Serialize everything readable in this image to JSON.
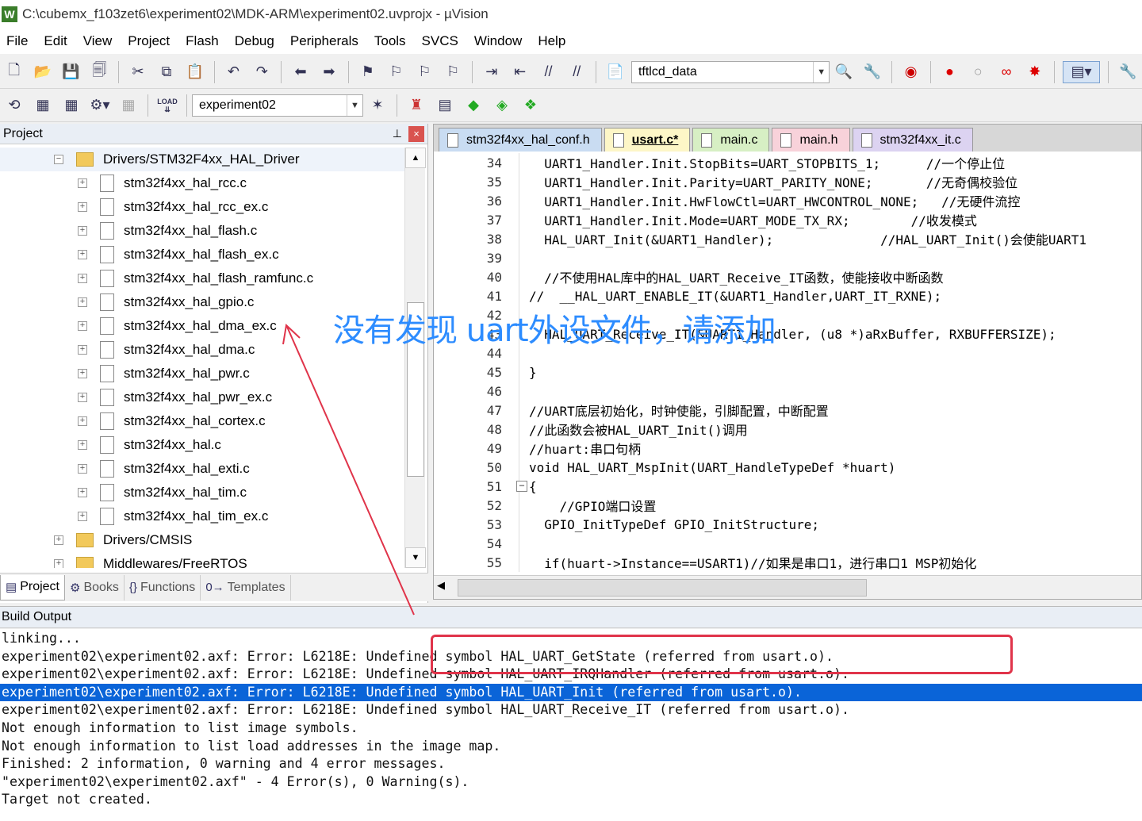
{
  "window": {
    "title": "C:\\cubemx_f103zet6\\experiment02\\MDK-ARM\\experiment02.uvprojx - µVision",
    "app_icon": "W"
  },
  "menu": [
    "File",
    "Edit",
    "View",
    "Project",
    "Flash",
    "Debug",
    "Peripherals",
    "Tools",
    "SVCS",
    "Window",
    "Help"
  ],
  "toolbar1": {
    "find_combo_value": "tftlcd_data"
  },
  "toolbar2": {
    "load_label": "LOAD",
    "target_combo_value": "experiment02"
  },
  "project_panel": {
    "title": "Project",
    "pin_glyph": "📌",
    "close_glyph": "×",
    "tree": [
      {
        "label": "Drivers/STM32F4xx_HAL_Driver",
        "type": "folder",
        "level": 1,
        "expanded": true
      },
      {
        "label": "stm32f4xx_hal_rcc.c",
        "type": "file",
        "level": 2
      },
      {
        "label": "stm32f4xx_hal_rcc_ex.c",
        "type": "file",
        "level": 2
      },
      {
        "label": "stm32f4xx_hal_flash.c",
        "type": "file",
        "level": 2
      },
      {
        "label": "stm32f4xx_hal_flash_ex.c",
        "type": "file",
        "level": 2
      },
      {
        "label": "stm32f4xx_hal_flash_ramfunc.c",
        "type": "file",
        "level": 2
      },
      {
        "label": "stm32f4xx_hal_gpio.c",
        "type": "file",
        "level": 2
      },
      {
        "label": "stm32f4xx_hal_dma_ex.c",
        "type": "file",
        "level": 2
      },
      {
        "label": "stm32f4xx_hal_dma.c",
        "type": "file",
        "level": 2
      },
      {
        "label": "stm32f4xx_hal_pwr.c",
        "type": "file",
        "level": 2
      },
      {
        "label": "stm32f4xx_hal_pwr_ex.c",
        "type": "file",
        "level": 2
      },
      {
        "label": "stm32f4xx_hal_cortex.c",
        "type": "file",
        "level": 2
      },
      {
        "label": "stm32f4xx_hal.c",
        "type": "file",
        "level": 2
      },
      {
        "label": "stm32f4xx_hal_exti.c",
        "type": "file",
        "level": 2
      },
      {
        "label": "stm32f4xx_hal_tim.c",
        "type": "file",
        "level": 2
      },
      {
        "label": "stm32f4xx_hal_tim_ex.c",
        "type": "file",
        "level": 2
      },
      {
        "label": "Drivers/CMSIS",
        "type": "folder",
        "level": 1,
        "expanded": false
      },
      {
        "label": "Middlewares/FreeRTOS",
        "type": "folder",
        "level": 1,
        "expanded": false
      }
    ],
    "tabs": [
      {
        "label": "Project",
        "icon": "project-icon",
        "glyph": "▤",
        "active": true
      },
      {
        "label": "Books",
        "icon": "books-icon",
        "glyph": "⚙",
        "active": false
      },
      {
        "label": "Functions",
        "icon": "functions-icon",
        "glyph": "{}",
        "active": false
      },
      {
        "label": "Templates",
        "icon": "templates-icon",
        "glyph": "0→",
        "active": false
      }
    ]
  },
  "editor": {
    "tabs": [
      {
        "label": "stm32f4xx_hal_conf.h",
        "active": false
      },
      {
        "label": "usart.c*",
        "active": true
      },
      {
        "label": "main.c",
        "active": false
      },
      {
        "label": "main.h",
        "active": false
      },
      {
        "label": "stm32f4xx_it.c",
        "active": false
      }
    ],
    "lines": [
      {
        "num": "34",
        "text": "  UART1_Handler.Init.StopBits=UART_STOPBITS_1;      //一个停止位"
      },
      {
        "num": "35",
        "text": "  UART1_Handler.Init.Parity=UART_PARITY_NONE;       //无奇偶校验位"
      },
      {
        "num": "36",
        "text": "  UART1_Handler.Init.HwFlowCtl=UART_HWCONTROL_NONE;   //无硬件流控"
      },
      {
        "num": "37",
        "text": "  UART1_Handler.Init.Mode=UART_MODE_TX_RX;        //收发模式"
      },
      {
        "num": "38",
        "text": "  HAL_UART_Init(&UART1_Handler);              //HAL_UART_Init()会使能UART1"
      },
      {
        "num": "39",
        "text": ""
      },
      {
        "num": "40",
        "text": "  //不使用HAL库中的HAL_UART_Receive_IT函数，使能接收中断函数"
      },
      {
        "num": "41",
        "text": "//  __HAL_UART_ENABLE_IT(&UART1_Handler,UART_IT_RXNE);"
      },
      {
        "num": "42",
        "text": ""
      },
      {
        "num": "43",
        "text": "  HAL_UART_Receive_IT(&UART1_Handler, (u8 *)aRxBuffer, RXBUFFERSIZE);"
      },
      {
        "num": "44",
        "text": ""
      },
      {
        "num": "45",
        "text": "}"
      },
      {
        "num": "46",
        "text": ""
      },
      {
        "num": "47",
        "text": "//UART底层初始化，时钟使能，引脚配置，中断配置"
      },
      {
        "num": "48",
        "text": "//此函数会被HAL_UART_Init()调用"
      },
      {
        "num": "49",
        "text": "//huart:串口句柄"
      },
      {
        "num": "50",
        "text": "void HAL_UART_MspInit(UART_HandleTypeDef *huart)"
      },
      {
        "num": "51",
        "text": "{"
      },
      {
        "num": "52",
        "text": "    //GPIO端口设置"
      },
      {
        "num": "53",
        "text": "  GPIO_InitTypeDef GPIO_InitStructure;"
      },
      {
        "num": "54",
        "text": ""
      },
      {
        "num": "55",
        "text": "  if(huart->Instance==USART1)//如果是串口1，进行串口1 MSP初始化"
      }
    ]
  },
  "build_output": {
    "title": "Build Output",
    "lines": [
      {
        "text": "linking...",
        "highlight": false
      },
      {
        "text": "experiment02\\experiment02.axf: Error: L6218E: Undefined symbol HAL_UART_GetState (referred from usart.o).",
        "highlight": false
      },
      {
        "text": "experiment02\\experiment02.axf: Error: L6218E: Undefined symbol HAL_UART_IRQHandler (referred from usart.o).",
        "highlight": false
      },
      {
        "text": "experiment02\\experiment02.axf: Error: L6218E: Undefined symbol HAL_UART_Init (referred from usart.o).",
        "highlight": true
      },
      {
        "text": "experiment02\\experiment02.axf: Error: L6218E: Undefined symbol HAL_UART_Receive_IT (referred from usart.o).",
        "highlight": false
      },
      {
        "text": "Not enough information to list image symbols.",
        "highlight": false
      },
      {
        "text": "Not enough information to list load addresses in the image map.",
        "highlight": false
      },
      {
        "text": "Finished: 2 information, 0 warning and 4 error messages.",
        "highlight": false
      },
      {
        "text": "\"experiment02\\experiment02.axf\" - 4 Error(s), 0 Warning(s).",
        "highlight": false
      },
      {
        "text": "Target not created.",
        "highlight": false
      }
    ]
  },
  "annotation": {
    "text": "没有发现 uart外设文件，请添加",
    "color": "#2d8cff",
    "box_color": "#e0344a"
  }
}
